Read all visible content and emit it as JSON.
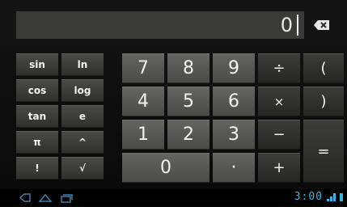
{
  "display": {
    "value": "0",
    "clear_icon": "backspace-icon"
  },
  "functions": [
    "sin",
    "ln",
    "cos",
    "log",
    "tan",
    "e",
    "π",
    "^",
    "!",
    "√"
  ],
  "keypad": {
    "row1": [
      "7",
      "8",
      "9",
      "÷",
      "("
    ],
    "row2": [
      "4",
      "5",
      "6",
      "×",
      ")"
    ],
    "row3": [
      "1",
      "2",
      "3",
      "−"
    ],
    "row4": [
      "0",
      "·",
      "+"
    ],
    "equals": "="
  },
  "statusbar": {
    "time": "3:00",
    "accent_color": "#33b5e5"
  },
  "navbar": {
    "icons": [
      "back-icon",
      "home-icon",
      "recent-apps-icon"
    ]
  }
}
